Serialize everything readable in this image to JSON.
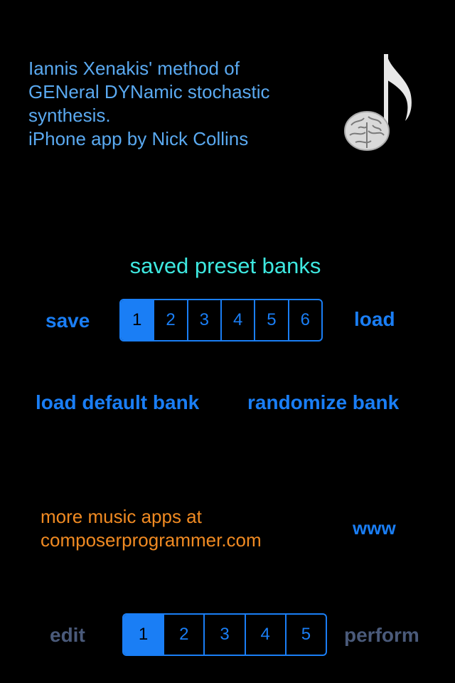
{
  "intro": {
    "line1": "Iannis Xenakis' method of",
    "line2": "GENeral DYNamic stochastic",
    "line3": "synthesis.",
    "line4": "iPhone app by Nick Collins"
  },
  "presets": {
    "title": "saved preset banks",
    "save_label": "save",
    "load_label": "load",
    "banks": [
      "1",
      "2",
      "3",
      "4",
      "5",
      "6"
    ],
    "selected_bank": "1",
    "load_default_label": "load default bank",
    "randomize_label": "randomize bank"
  },
  "promo": {
    "line1": "more music apps at",
    "line2": "composerprogrammer.com",
    "www_label": "www"
  },
  "footer": {
    "edit_label": "edit",
    "perform_label": "perform",
    "pages": [
      "1",
      "2",
      "3",
      "4",
      "5"
    ],
    "selected_page": "1"
  },
  "colors": {
    "background": "#000000",
    "accent_blue": "#1a7ef5",
    "intro_text": "#5aa9f0",
    "title_cyan": "#3ee8e0",
    "promo_orange": "#f08a22",
    "disabled_gray": "#4a5a7a"
  },
  "icons": {
    "logo": "brain-music-note-icon"
  }
}
